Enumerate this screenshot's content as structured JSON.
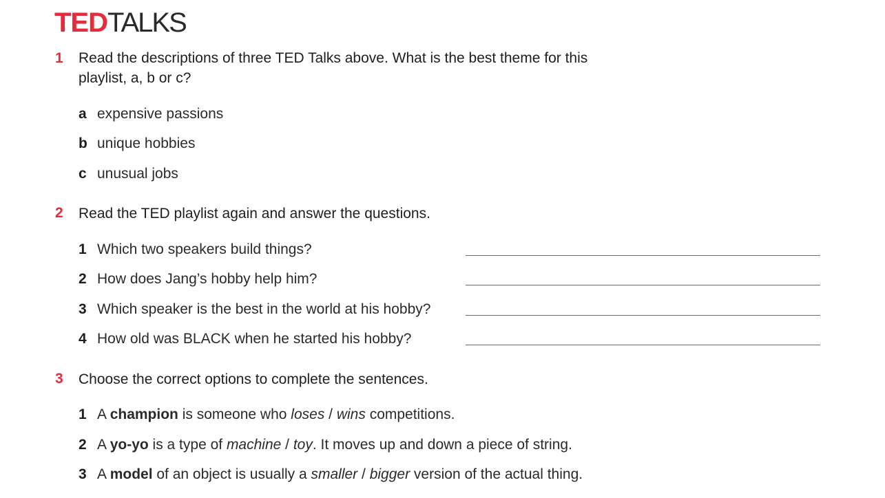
{
  "logo": {
    "ted": "TED",
    "talks": "TALKS"
  },
  "exercise1": {
    "number": "1",
    "instruction_line1": "Read the descriptions of three TED Talks above. What is the best theme for this",
    "instruction_line2": "playlist, a, b or c?",
    "options": [
      {
        "key": "a",
        "text": "expensive passions"
      },
      {
        "key": "b",
        "text": "unique hobbies"
      },
      {
        "key": "c",
        "text": "unusual jobs"
      }
    ]
  },
  "exercise2": {
    "number": "2",
    "instruction": "Read the TED playlist again and answer the questions.",
    "questions": [
      {
        "num": "1",
        "text": "Which two speakers build things?"
      },
      {
        "num": "2",
        "text": "How does Jang’s hobby help him?"
      },
      {
        "num": "3",
        "text": "Which speaker is the best in the world at his hobby?"
      },
      {
        "num": "4",
        "text": "How old was BLACK when he started his hobby?"
      }
    ]
  },
  "exercise3": {
    "number": "3",
    "instruction": "Choose the correct options to complete the sentences.",
    "sentences": [
      {
        "num": "1",
        "pre": "A ",
        "term": "champion",
        "mid": " is someone who ",
        "opt1": "loses",
        "sep": " / ",
        "opt2": "wins",
        "post": " competitions."
      },
      {
        "num": "2",
        "pre": "A ",
        "term": "yo-yo",
        "mid": " is a type of ",
        "opt1": "machine",
        "sep": " / ",
        "opt2": "toy",
        "post": ". It moves up and down a piece of string."
      },
      {
        "num": "3",
        "pre": "A ",
        "term": "model",
        "mid": " of an object is usually a ",
        "opt1": "smaller",
        "sep": " / ",
        "opt2": "bigger",
        "post": " version of the actual thing."
      }
    ]
  }
}
